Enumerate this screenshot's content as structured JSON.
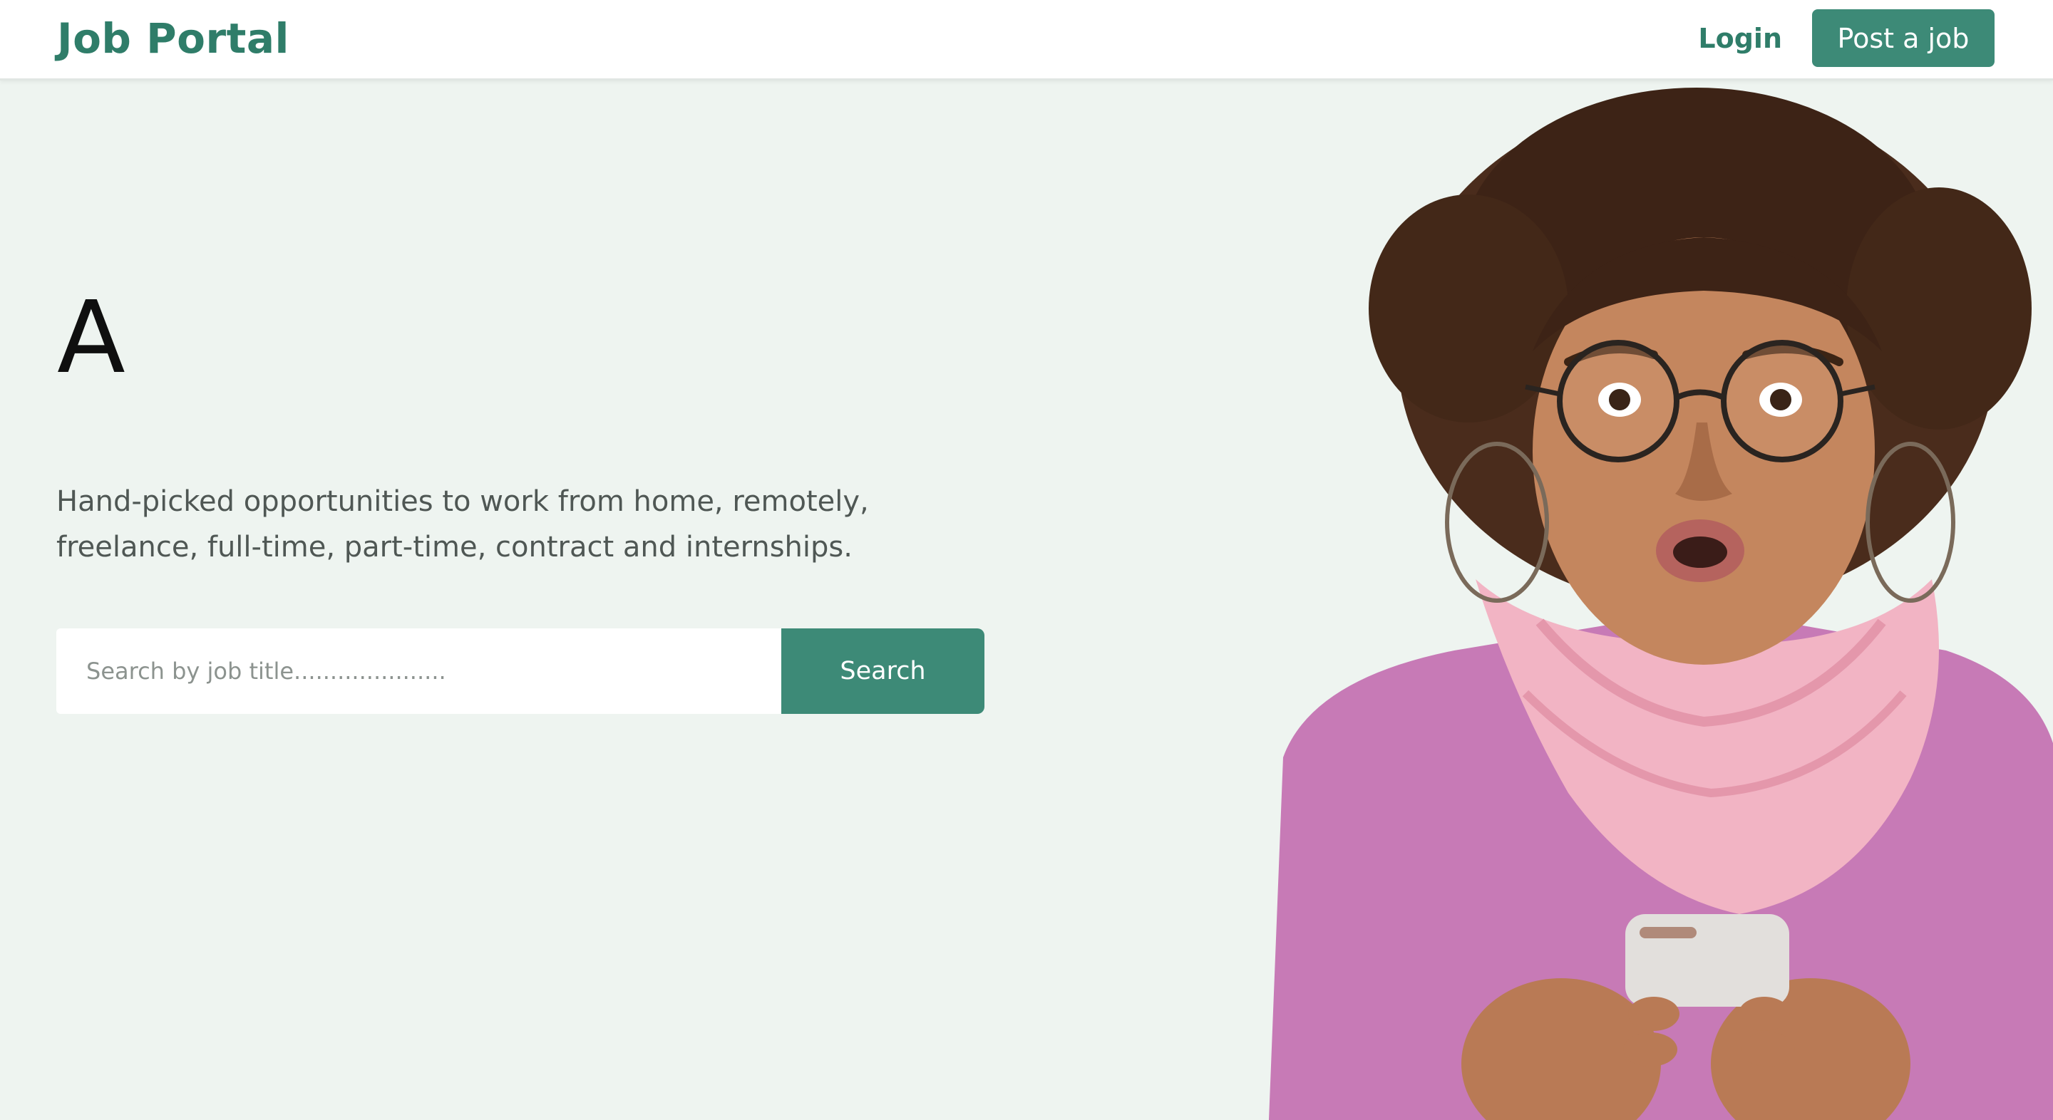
{
  "header": {
    "brand": "Job Portal",
    "login_label": "Login",
    "post_job_label": "Post a job"
  },
  "hero": {
    "headline": "A",
    "subtitle": "Hand-picked opportunities to work from home, remotely, freelance, full-time, part-time, contract and internships.",
    "search": {
      "placeholder": "Search by job title.....................",
      "button_label": "Search"
    }
  },
  "colors": {
    "brand_green": "#2f7d69",
    "button_green": "#3d8a77",
    "page_background": "#eef4f0"
  }
}
